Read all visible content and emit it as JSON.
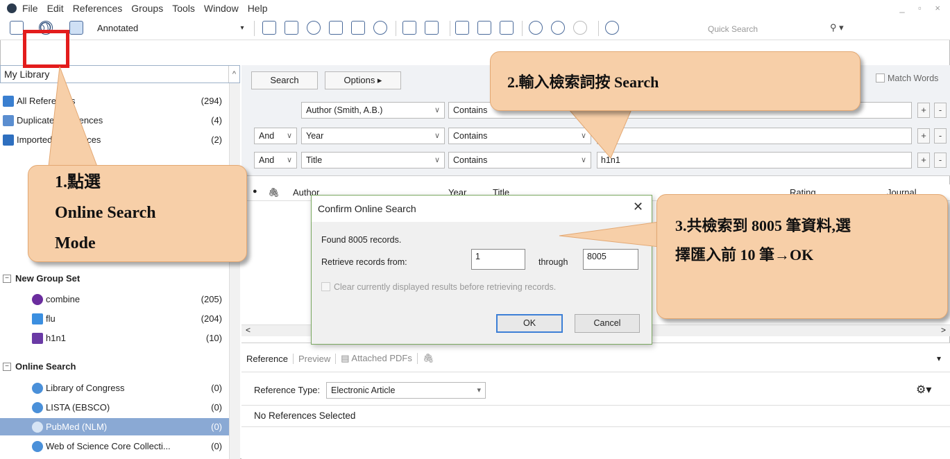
{
  "menu": [
    "File",
    "Edit",
    "References",
    "Groups",
    "Tools",
    "Window",
    "Help"
  ],
  "toolbar": {
    "style": "Annotated",
    "quick_search_placeholder": "Quick Search"
  },
  "library": {
    "header": "My Library",
    "items": [
      {
        "label": "All References",
        "count": "(294)"
      },
      {
        "label": "Duplicate References",
        "count": "(4)"
      },
      {
        "label": "Imported References",
        "count": "(2)"
      }
    ]
  },
  "groups": {
    "new_group_set": "New Group Set",
    "items": [
      {
        "label": "combine",
        "count": "(205)"
      },
      {
        "label": "flu",
        "count": "(204)"
      },
      {
        "label": "h1n1",
        "count": "(10)"
      }
    ]
  },
  "online_search": {
    "title": "Online Search",
    "items": [
      {
        "label": "Library of Congress",
        "count": "(0)"
      },
      {
        "label": "LISTA (EBSCO)",
        "count": "(0)"
      },
      {
        "label": "PubMed (NLM)",
        "count": "(0)",
        "selected": true
      },
      {
        "label": "Web of Science Core Collecti...",
        "count": "(0)"
      }
    ]
  },
  "search_panel": {
    "search_button": "Search",
    "options_button": "Options ▸",
    "match_words": "Match Words",
    "rows": [
      {
        "bool": "",
        "field": "Author (Smith, A.B.)",
        "op": "Contains",
        "value": ""
      },
      {
        "bool": "And",
        "field": "Year",
        "op": "Contains",
        "value": ""
      },
      {
        "bool": "And",
        "field": "Title",
        "op": "Contains",
        "value": "h1n1"
      }
    ]
  },
  "results_columns": [
    "Author",
    "Year",
    "Title",
    "Rating",
    "Journal"
  ],
  "dialog": {
    "title": "Confirm Online Search",
    "found": "Found 8005 records.",
    "retrieve_label": "Retrieve records from:",
    "from_value": "1",
    "through_label": "through",
    "to_value": "8005",
    "clear_label": "Clear currently displayed results before retrieving records.",
    "ok": "OK",
    "cancel": "Cancel"
  },
  "bottom": {
    "tabs": [
      "Reference",
      "Preview",
      "Attached PDFs"
    ],
    "ref_type_label": "Reference Type:",
    "ref_type_value": "Electronic Article",
    "no_refs": "No References Selected"
  },
  "callouts": {
    "step1_line1": "1.點選",
    "step1_line2": "Online Search",
    "step1_line3": "Mode",
    "step2": "2.輸入檢索詞按 Search",
    "step3_line1": "3.共檢索到 8005 筆資料,選",
    "step3_line2": "擇匯入前 10 筆→OK"
  },
  "colors": {
    "callout_fill": "#f7cfa8",
    "highlight_red": "#e31c1c",
    "selected_row": "#8aa9d4"
  }
}
